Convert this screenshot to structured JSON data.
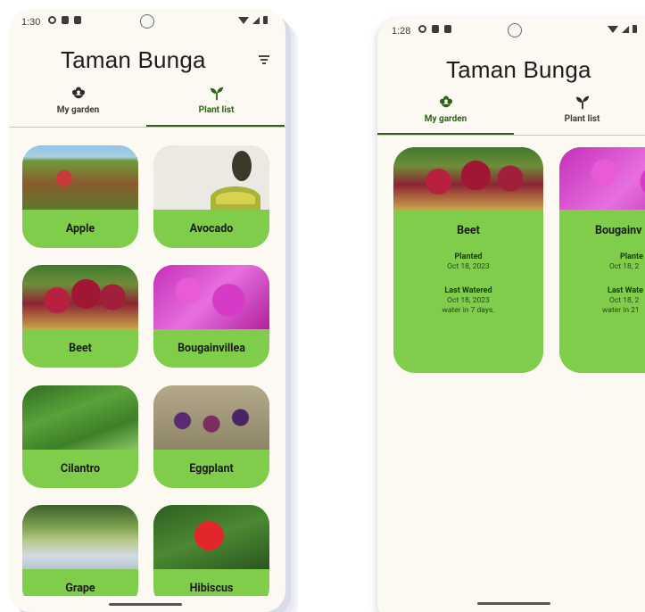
{
  "app": {
    "title": "Taman Bunga"
  },
  "left_phone": {
    "status_time": "1:30",
    "tabs": [
      {
        "label": "My garden",
        "icon": "flower-icon",
        "active": false
      },
      {
        "label": "Plant list",
        "icon": "sprout-icon",
        "active": true
      }
    ],
    "plants": [
      {
        "name": "Apple"
      },
      {
        "name": "Avocado"
      },
      {
        "name": "Beet"
      },
      {
        "name": "Bougainvillea"
      },
      {
        "name": "Cilantro"
      },
      {
        "name": "Eggplant"
      },
      {
        "name": "Grape"
      },
      {
        "name": "Hibiscus"
      }
    ]
  },
  "right_phone": {
    "status_time": "1:28",
    "tabs": [
      {
        "label": "My garden",
        "icon": "flower-icon",
        "active": true
      },
      {
        "label": "Plant list",
        "icon": "sprout-icon",
        "active": false
      }
    ],
    "garden": [
      {
        "name": "Beet",
        "planted_label": "Planted",
        "planted": "Oct 18, 2023",
        "watered_label": "Last Watered",
        "watered": "Oct 18, 2023",
        "next": "water in 7 days."
      },
      {
        "name": "Bougainv",
        "planted_label": "Plante",
        "planted": "Oct 18, 2",
        "watered_label": "Last Wate",
        "watered": "Oct 18, 2",
        "next": "water in 21"
      }
    ]
  },
  "colors": {
    "card_green": "#80cd4c",
    "accent_dark_green": "#2d6317",
    "background": "#fbf9f1"
  }
}
